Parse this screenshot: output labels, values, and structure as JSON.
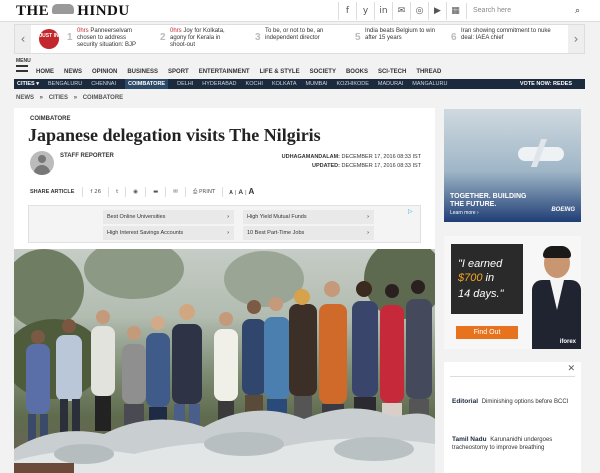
{
  "site": {
    "logo_left": "THE",
    "logo_right": "HINDU"
  },
  "header": {
    "social": [
      "f",
      "y",
      "in",
      "✉",
      "◎",
      "▶",
      "▦"
    ],
    "search_placeholder": "Search here"
  },
  "ticker": {
    "badge": "JUST IN",
    "items": [
      {
        "num": "1",
        "time": "0hrs",
        "text": "Panneerselvam chosen to address security situation: BJP"
      },
      {
        "num": "2",
        "time": "0hrs",
        "text": "Joy for Kolkata, agony for Kerala in shoot-out"
      },
      {
        "num": "3",
        "time": "",
        "text": "To be, or not to be, an independent director"
      },
      {
        "num": "5",
        "time": "",
        "text": "India beats Belgium to win after 15 years"
      },
      {
        "num": "6",
        "time": "",
        "text": "Iran showing commitment to nuke deal: IAEA chief"
      }
    ]
  },
  "menu": {
    "label": "MENU",
    "nav": [
      "HOME",
      "NEWS",
      "OPINION",
      "BUSINESS",
      "SPORT",
      "ENTERTAINMENT",
      "LIFE & STYLE",
      "SOCIETY",
      "BOOKS",
      "SCI-TECH",
      "THREAD"
    ],
    "cities_label": "CITIES ▾",
    "cities": [
      "BENGALURU",
      "CHENNAI",
      "COIMBATORE",
      "DELHI",
      "HYDERABAD",
      "KOCHI",
      "KOLKATA",
      "MUMBAI",
      "KOZHIKODE",
      "MADURAI",
      "MANGALURU"
    ],
    "active_city": "COIMBATORE",
    "vote": "VOTE NOW: REDES"
  },
  "breadcrumb": [
    "NEWS",
    "»",
    "CITIES",
    "»",
    "COIMBATORE"
  ],
  "article": {
    "kicker": "COIMBATORE",
    "headline": "Japanese delegation visits The Nilgiris",
    "byline": "STAFF REPORTER",
    "dateline_label": "UDHAGAMANDALAM:",
    "dateline": "DECEMBER 17, 2016 08:33 IST",
    "updated_label": "UPDATED:",
    "updated": "DECEMBER 17, 2016 08:33 IST",
    "share_label": "SHARE ARTICLE",
    "share_count": "f 26",
    "share_twitter": "t",
    "share_reddit": "◉",
    "share_comments": "▬",
    "share_email": "✉",
    "print_label": "⎙ PRINT",
    "font_sizes": [
      "A",
      "A",
      "A"
    ]
  },
  "ad_links": [
    "Best Online Universities",
    "High Yield Mutual Funds",
    "High Interest Savings Accounts",
    "10 Best Part-Time Jobs"
  ],
  "ad_choices": "▷",
  "ad_boeing": {
    "tagline": "TOGETHER. BUILDING THE FUTURE.",
    "learn": "Learn more ›",
    "brand": "BOEING"
  },
  "ad_forex": {
    "line1": "\"I earned",
    "amount": "$700",
    "line2_rest": " in",
    "line3": "14 days.\"",
    "cta": "Find Out",
    "brand": "iforex"
  },
  "sidebar": {
    "close": "✕",
    "items": [
      {
        "category": "Editorial",
        "text": "Diminishing options before BCCI"
      },
      {
        "category": "Tamil Nadu",
        "text": "Karunanidhi undergoes tracheostomy to improve breathing"
      }
    ]
  }
}
